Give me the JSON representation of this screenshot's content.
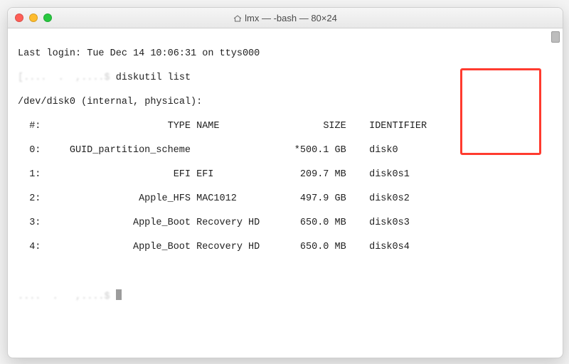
{
  "window": {
    "title": "lmx — -bash — 80×24"
  },
  "terminal": {
    "last_login": "Last login: Tue Dec 14 10:06:31 on ttys000",
    "prompt_obscured": "[....  .  ,....$",
    "command": "diskutil list",
    "device_line": "/dev/disk0 (internal, physical):",
    "header": {
      "num": "#:",
      "type": "TYPE",
      "name": "NAME",
      "size": "SIZE",
      "identifier": "IDENTIFIER"
    },
    "rows": [
      {
        "num": "0:",
        "type": "GUID_partition_scheme",
        "name": "",
        "size": "*500.1 GB",
        "identifier": "disk0"
      },
      {
        "num": "1:",
        "type": "EFI",
        "name": "EFI",
        "size": "209.7 MB",
        "identifier": "disk0s1"
      },
      {
        "num": "2:",
        "type": "Apple_HFS",
        "name": "MAC1012",
        "size": "497.9 GB",
        "identifier": "disk0s2"
      },
      {
        "num": "3:",
        "type": "Apple_Boot",
        "name": "Recovery HD",
        "size": "650.0 MB",
        "identifier": "disk0s3"
      },
      {
        "num": "4:",
        "type": "Apple_Boot",
        "name": "Recovery HD",
        "size": "650.0 MB",
        "identifier": "disk0s4"
      }
    ],
    "prompt2_obscured": "....  .   ,....$ "
  },
  "annotation": {
    "highlight_column": "IDENTIFIER"
  }
}
